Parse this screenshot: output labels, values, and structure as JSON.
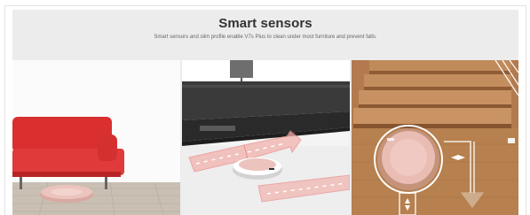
{
  "section": {
    "title": "Smart sensors",
    "subtitle": "Smart sensors and slim profile enable V7s Plus to clean under most furniture and prevent falls."
  },
  "photos": [
    {
      "icon": "robot-under-sofa-photo"
    },
    {
      "icon": "robot-path-navigation-photo"
    },
    {
      "icon": "robot-stairs-cliff-sensor-photo"
    }
  ],
  "colors": {
    "panel": "#ececec",
    "accent_path": "#e98a8a",
    "sofa": "#e23b3b",
    "robot": "#e8b8b2",
    "wood": "#b07a4f"
  }
}
